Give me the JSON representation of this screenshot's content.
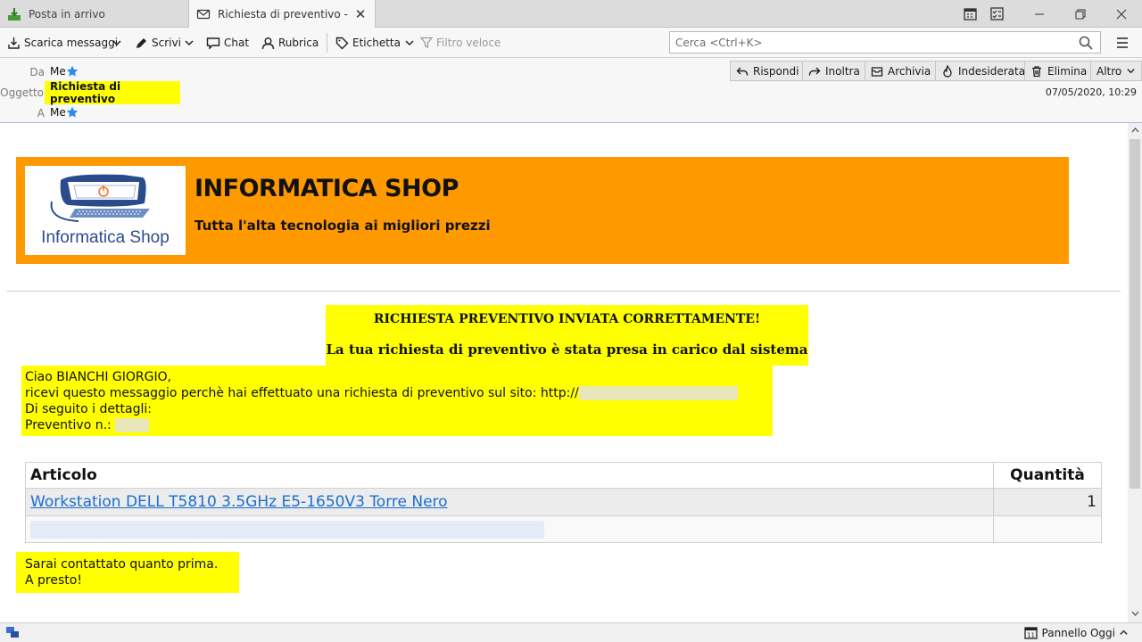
{
  "tabs": [
    {
      "label": "Posta in arrivo",
      "icon": "inbox-download-icon"
    },
    {
      "label": "Richiesta di preventivo - Posta in arrivo",
      "icon": "envelope-icon",
      "active": true
    }
  ],
  "toolbar": {
    "get_messages": "Scarica messaggi",
    "write": "Scrivi",
    "chat": "Chat",
    "address_book": "Rubrica",
    "tag": "Etichetta",
    "quick_filter": "Filtro veloce",
    "search_placeholder": "Cerca <Ctrl+K>"
  },
  "header": {
    "from_label": "Da",
    "from_value": "Me",
    "subject_label": "Oggetto",
    "subject_value": "Richiesta di preventivo",
    "to_label": "A",
    "to_value": "Me",
    "date": "07/05/2020, 10:29",
    "actions": {
      "reply": "Rispondi",
      "forward": "Inoltra",
      "archive": "Archivia",
      "junk": "Indesiderata",
      "delete": "Elimina",
      "more": "Altro"
    }
  },
  "email": {
    "shop_name": "INFORMATICA SHOP",
    "shop_tagline": "Tutta l'alta tecnologia ai migliori prezzi",
    "logo_text": "Informatica Shop",
    "confirm_title": "RICHIESTA PREVENTIVO INVIATA CORRETTAMENTE!",
    "confirm_sub": "La tua richiesta di preventivo è stata presa in carico dal sistema",
    "greeting": "Ciao BIANCHI GIORGIO,",
    "line1": "ricevi questo messaggio perchè hai effettuato una richiesta di preventivo sul sito: http://",
    "line2": "Di seguito i dettagli:",
    "line3": "Preventivo n.:",
    "table": {
      "col_item": "Articolo",
      "col_qty": "Quantità",
      "rows": [
        {
          "item": "Workstation DELL T5810 3.5GHz E5-1650V3 Torre Nero",
          "qty": "1"
        }
      ]
    },
    "closing1": "Sarai contattato quanto prima.",
    "closing2": "A presto!"
  },
  "status": {
    "today_pane": "Pannello Oggi"
  },
  "colors": {
    "banner": "#ff9900",
    "highlight": "#ffff00",
    "link": "#1a6ed0",
    "star": "#2d8ef0"
  }
}
